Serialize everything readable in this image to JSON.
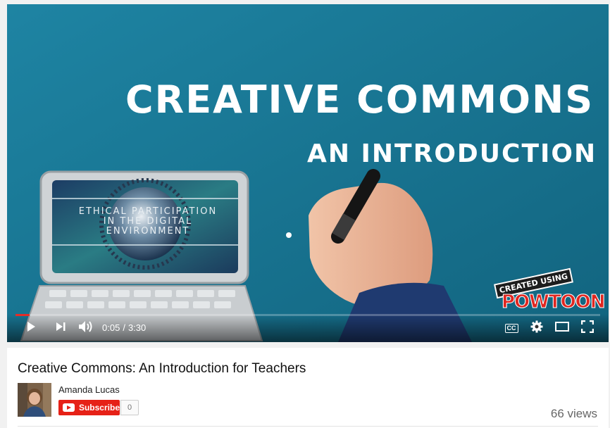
{
  "video": {
    "frame": {
      "title_line1": "CREATIVE COMMONS -",
      "title_line2": "AN INTRODUCTION",
      "screen_line1": "ETHICAL PARTICIPATION",
      "screen_line2": "IN THE DIGITAL",
      "screen_line3": "ENVIRONMENT",
      "badge_created": "CREATED USING",
      "badge_logo": "POWTOON"
    },
    "controls": {
      "current_time": "0:05",
      "separator": "/",
      "duration": "3:30",
      "progress_fraction": 0.024,
      "cc_label": "CC"
    },
    "icons": [
      "play-icon",
      "next-icon",
      "volume-icon",
      "captions-icon",
      "settings-icon",
      "theater-icon",
      "fullscreen-icon"
    ]
  },
  "info": {
    "title": "Creative Commons: An Introduction for Teachers",
    "channel": "Amanda Lucas",
    "subscribe_label": "Subscribe",
    "subscriber_count": "0",
    "views": "66 views"
  },
  "colors": {
    "video_bg": "#1a7796",
    "progress": "#e52d27",
    "subscribe": "#e62117"
  }
}
